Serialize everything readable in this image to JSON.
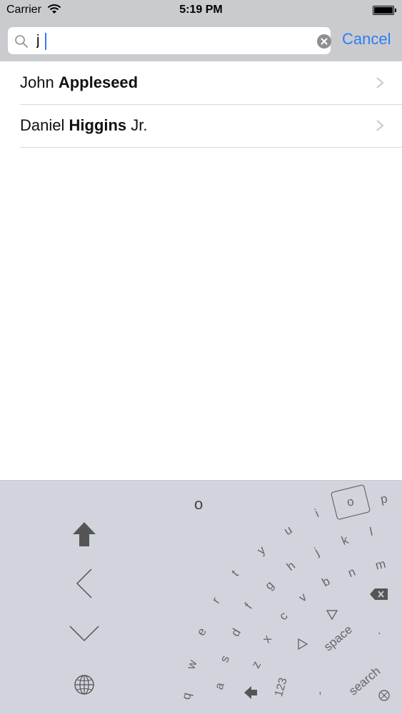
{
  "status_bar": {
    "carrier": "Carrier",
    "time": "5:19 PM"
  },
  "search": {
    "query": "j",
    "cancel_label": "Cancel"
  },
  "results": [
    {
      "first": "John",
      "last": "Appleseed",
      "suffix": ""
    },
    {
      "first": "Daniel",
      "last": "Higgins",
      "suffix": "Jr."
    }
  ],
  "keyboard": {
    "preview_letter": "o",
    "highlighted_key": "o",
    "keys": {
      "q": "q",
      "w": "w",
      "e": "e",
      "r": "r",
      "t": "t",
      "y": "y",
      "u": "u",
      "i": "i",
      "p": "p",
      "a": "a",
      "s": "s",
      "d": "d",
      "f": "f",
      "g": "g",
      "h": "h",
      "j": "j",
      "k": "k",
      "l": "l",
      "z": "z",
      "x": "x",
      "c": "c",
      "v": "v",
      "b": "b",
      "n": "n",
      "m": "m"
    },
    "comma": ",",
    "period": ".",
    "numbers_label": "123",
    "space_label": "space",
    "search_label": "search"
  },
  "colors": {
    "accent": "#2f7df6",
    "bar_bg": "#c9cbcf",
    "keyboard_bg": "#d1d4dc"
  },
  "icons": [
    "wifi-icon",
    "battery-icon",
    "search-icon",
    "clear-icon",
    "chevron-right-icon",
    "shift-icon",
    "chevron-left-icon",
    "chevron-down-icon",
    "globe-icon",
    "backspace-icon",
    "triangle-icon",
    "emoji-icon"
  ]
}
